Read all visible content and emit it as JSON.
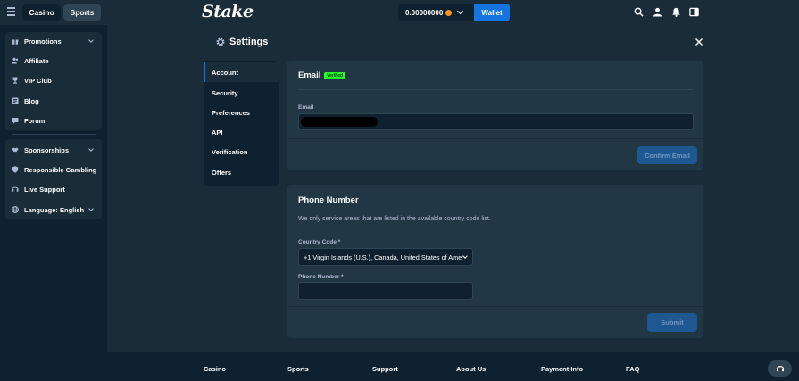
{
  "header": {
    "casino_label": "Casino",
    "sports_label": "Sports",
    "logo_text": "Stake",
    "balance": "0.00000000",
    "wallet_label": "Wallet",
    "icons": [
      "menu-icon",
      "search-icon",
      "user-icon",
      "bell-icon",
      "sidebar-toggle-icon"
    ]
  },
  "sidebar": {
    "group1": [
      {
        "label": "Promotions",
        "icon": "gift-icon",
        "has_chevron": true
      },
      {
        "label": "Affiliate",
        "icon": "users-icon"
      },
      {
        "label": "VIP Club",
        "icon": "trophy-icon"
      },
      {
        "label": "Blog",
        "icon": "blog-icon"
      },
      {
        "label": "Forum",
        "icon": "forum-icon"
      }
    ],
    "group2": [
      {
        "label": "Sponsorships",
        "icon": "handshake-icon",
        "has_chevron": true
      },
      {
        "label": "Responsible Gambling",
        "icon": "shield-icon"
      },
      {
        "label": "Live Support",
        "icon": "headset-icon"
      },
      {
        "label": "Language: English",
        "icon": "globe-icon",
        "has_chevron": true
      }
    ]
  },
  "settings": {
    "title": "Settings",
    "menu": [
      "Account",
      "Security",
      "Preferences",
      "API",
      "Verification",
      "Offers"
    ],
    "active_tab": "Account"
  },
  "email_card": {
    "title": "Email",
    "badge": "Verified",
    "field_label": "Email",
    "field_value": "",
    "button": "Confirm Email"
  },
  "phone_card": {
    "title": "Phone Number",
    "note": "We only service areas that are listed in the available country code list.",
    "country_label": "Country Code *",
    "country_value": "+1 Virgin Islands (U.S.), Canada, United States of Ame",
    "phone_label": "Phone Number *",
    "phone_value": "",
    "button": "Submit"
  },
  "footer": {
    "links": [
      "Casino",
      "Sports",
      "Support",
      "About Us",
      "Payment Info",
      "FAQ"
    ]
  },
  "colors": {
    "background": "#0f212e",
    "panel": "#1a2c38",
    "card": "#213743",
    "accent": "#1475e1",
    "verified": "#1fff20"
  }
}
